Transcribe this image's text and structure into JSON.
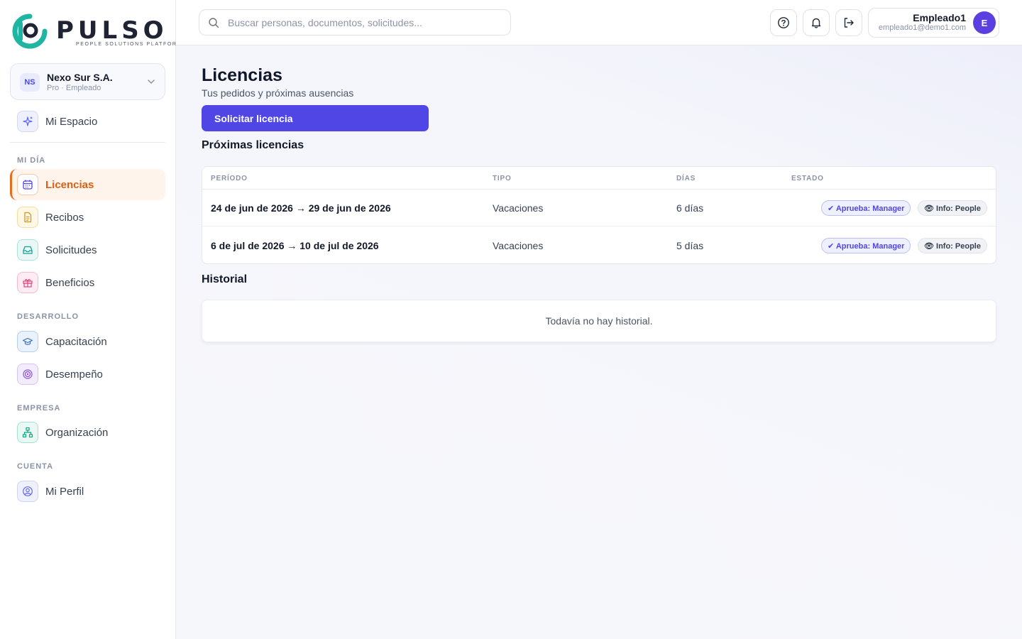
{
  "brand": {
    "name": "PULSO",
    "tagline": "PEOPLE SOLUTIONS PLATFORM",
    "colors": {
      "teal": "#1fb5a3",
      "dark": "#1f2333"
    }
  },
  "org": {
    "initials": "NS",
    "name": "Nexo Sur S.A.",
    "subtitle": "Pro · Empleado"
  },
  "sidebar": {
    "top_item": {
      "label": "Mi Espacio",
      "icon": "sparkles-icon"
    },
    "sections": [
      {
        "label": "MI DÍA"
      },
      {
        "label": "DESARROLLO"
      },
      {
        "label": "EMPRESA"
      },
      {
        "label": "CUENTA"
      }
    ],
    "items": [
      {
        "label": "Licencias",
        "icon": "calendar-icon",
        "active": true
      },
      {
        "label": "Recibos",
        "icon": "document-icon"
      },
      {
        "label": "Solicitudes",
        "icon": "inbox-icon"
      },
      {
        "label": "Beneficios",
        "icon": "gift-icon"
      },
      {
        "label": "Capacitación",
        "icon": "graduation-cap-icon"
      },
      {
        "label": "Desempeño",
        "icon": "target-icon"
      },
      {
        "label": "Organización",
        "icon": "org-chart-icon"
      },
      {
        "label": "Mi Perfil",
        "icon": "user-circle-icon"
      }
    ]
  },
  "header": {
    "search_placeholder": "Buscar personas, documentos, solicitudes...",
    "user": {
      "name": "Empleado1",
      "email": "empleado1@demo1.com",
      "initial": "E"
    }
  },
  "main": {
    "title": "Licencias",
    "subtitle": "Tus pedidos y próximas ausencias",
    "request_button": "Solicitar licencia",
    "upcoming": {
      "title": "Próximas licencias",
      "columns": [
        "PERÍODO",
        "TIPO",
        "DÍAS",
        "ESTADO"
      ],
      "rows": [
        {
          "period": "24 de jun de 2026 → 29 de jun de 2026",
          "type": "Vacaciones",
          "days": "6 días",
          "approve": "✔ Aprueba: Manager",
          "info": "👁 Info: People"
        },
        {
          "period": "6 de jul de 2026 → 10 de jul de 2026",
          "type": "Vacaciones",
          "days": "5 días",
          "approve": "✔ Aprueba: Manager",
          "info": "👁 Info: People"
        }
      ]
    },
    "history": {
      "title": "Historial",
      "empty": "Todavía no hay historial."
    }
  },
  "colors": {
    "primary": "#4f46e5",
    "active_accent": "#ea6d1f",
    "active_bg": "#fff4ec"
  }
}
